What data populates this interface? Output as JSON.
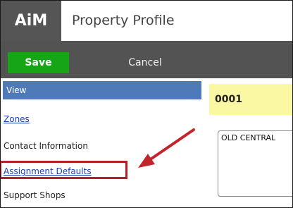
{
  "header": {
    "logo_text": "AiM",
    "title": "Property Profile"
  },
  "toolbar": {
    "save_label": "Save",
    "cancel_label": "Cancel"
  },
  "sidebar": {
    "section_label": "View",
    "items": [
      {
        "label": "Zones",
        "link": true
      },
      {
        "label": "Contact Information",
        "link": false
      },
      {
        "label": "Assignment Defaults",
        "link": true,
        "highlighted": true
      },
      {
        "label": "Support Shops",
        "link": false
      }
    ]
  },
  "main": {
    "record_id": "0001",
    "description_value": "OLD CENTRAL"
  },
  "colors": {
    "logo_bg": "#555555",
    "toolbar_bg": "#535353",
    "save_green": "#16a516",
    "sidebar_header_blue": "#4f7ab8",
    "record_bar_yellow": "#fbf8a3",
    "annotation_red": "#b22227",
    "link_blue": "#1a3fb0"
  }
}
